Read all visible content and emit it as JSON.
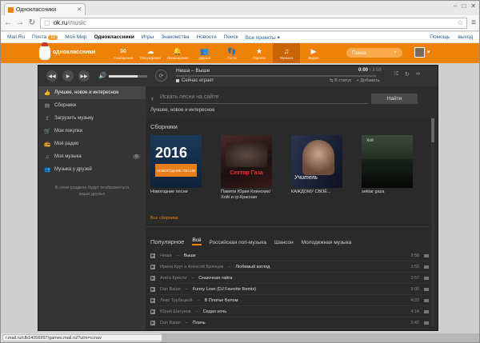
{
  "browser": {
    "tab_title": "Одноклассники",
    "url_domain": "ok.ru",
    "url_path": "/music",
    "back_icon": "arrow-left-icon",
    "forward_icon": "arrow-right-icon",
    "reload_icon": "reload-icon"
  },
  "mailbar": {
    "items": [
      "Mail.Ru",
      "Почта",
      "Мой Мир",
      "Одноклассники",
      "Игры",
      "Знакомства",
      "Новости",
      "Поиск",
      "Все проекты ▾"
    ],
    "mail_count": "10",
    "help": "Помощь",
    "logout": "выход"
  },
  "okhead": {
    "logo_text": "одноклассники",
    "nav": [
      {
        "label": "Сообщения",
        "icon": "✉"
      },
      {
        "label": "Обсуждения",
        "icon": "☁"
      },
      {
        "label": "Оповещения",
        "icon": "🔔"
      },
      {
        "label": "Друзья",
        "icon": "👥"
      },
      {
        "label": "Гости",
        "icon": "👣"
      },
      {
        "label": "Оценки",
        "icon": "★"
      },
      {
        "label": "Музыка",
        "icon": "♫"
      },
      {
        "label": "Видео",
        "icon": "▶"
      }
    ],
    "search_placeholder": "Поиск"
  },
  "player": {
    "track": "Неша – Выше",
    "time_current": "0:00",
    "time_total": "3:58",
    "now_playing": "Сейчас играет",
    "to_status": "В статус",
    "add": "Добавить",
    "volume": 0.75
  },
  "sidebar": {
    "items": [
      {
        "label": "Лучшее, новое и интересное",
        "icon": "👍"
      },
      {
        "label": "Сборники",
        "icon": "▤"
      },
      {
        "label": "Загрузить музыку",
        "icon": "⇪"
      },
      {
        "label": "Мои покупки",
        "icon": "🛒"
      },
      {
        "label": "Моё радио",
        "icon": "📻"
      },
      {
        "label": "Моя музыка",
        "icon": "♫",
        "count": "0"
      },
      {
        "label": "Музыка у друзей",
        "icon": "👥"
      }
    ],
    "note": "В этом разделе будут отображаться ваши друзья"
  },
  "main": {
    "search_placeholder": "Искать песни на сайте",
    "find_button": "Найти",
    "breadcrumb": "Лучшее, новое и интересное",
    "collections_title": "Сборники",
    "albums": [
      {
        "name": "Новогодние песни",
        "cover_year": "2016",
        "cover_caption": "НОВОГОДНИЕ ПЕСНИ"
      },
      {
        "name": "Памяти Юрия Клинских/Хой/ и гр.Красная",
        "cover_caption": "Сектор Газа"
      },
      {
        "name": "КАЖДОМУ СВОЁ...",
        "cover_caption": "Учитель"
      },
      {
        "name": "sektar gaza",
        "cover_caption": "Хой"
      }
    ],
    "all_collections": "Все сборники",
    "tabs_label": "Популярное",
    "tabs": [
      "Всё",
      "Российская поп-музыка",
      "Шансон",
      "Молодежная музыка"
    ],
    "tracks": [
      {
        "artist": "Неша",
        "title": "Выше",
        "duration": "3:58"
      },
      {
        "artist": "Ирина Круг и Алексей Брянцев",
        "title": "Любимый взгляд",
        "duration": "3:56"
      },
      {
        "artist": "Агата Кристи",
        "title": "Сказочная тайга",
        "duration": "3:57"
      },
      {
        "artist": "Dan Balan",
        "title": "Funny Love (DJ Favorite Remix)",
        "duration": "3:00"
      },
      {
        "artist": "Левс Трубецкой",
        "title": "В Платье Белом",
        "duration": "4:33"
      },
      {
        "artist": "Юрий Шатунов",
        "title": "Седая ночь",
        "duration": "4:14"
      },
      {
        "artist": "Dan Balan",
        "title": "Плачь",
        "duration": "3:42"
      }
    ]
  },
  "statusbar": "r.mail.ru/clb14056997/games.mail.ru/?utm=ccnav",
  "colors": {
    "accent": "#ee8208",
    "player_bg": "#2d2d2d"
  }
}
